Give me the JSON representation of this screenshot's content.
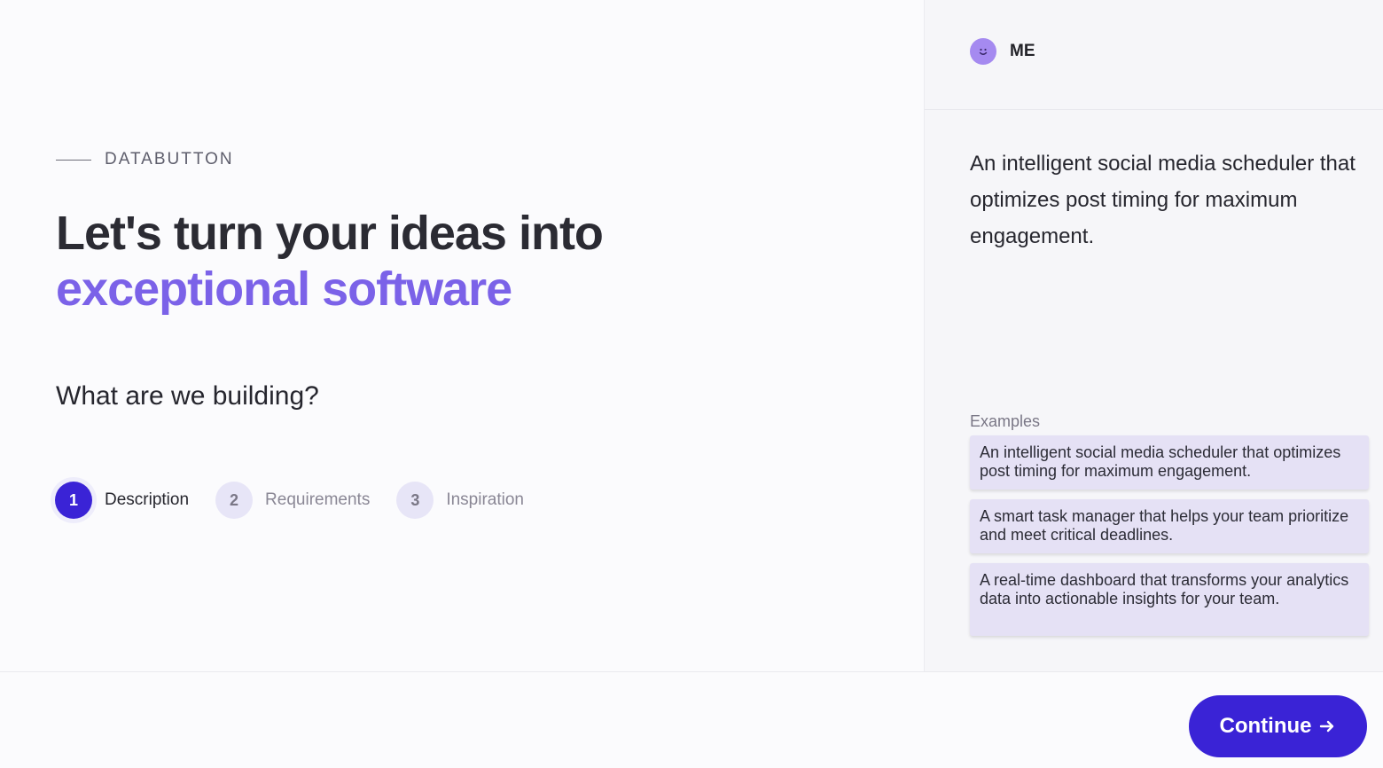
{
  "brand": {
    "eyebrow": "DATABUTTON"
  },
  "hero": {
    "line1": "Let's turn your ideas into",
    "line2": "exceptional software",
    "accent_color": "#7b62e8"
  },
  "question": "What are we building?",
  "steps": [
    {
      "number": "1",
      "label": "Description",
      "active": true
    },
    {
      "number": "2",
      "label": "Requirements",
      "active": false
    },
    {
      "number": "3",
      "label": "Inspiration",
      "active": false
    }
  ],
  "panel": {
    "author": "ME",
    "avatar_icon": "smiley-face-icon",
    "prompt": "An intelligent social media scheduler that optimizes post timing for maximum engagement.",
    "examples_label": "Examples",
    "examples": [
      "An intelligent social media scheduler that optimizes post timing for maximum engagement.",
      "A smart task manager that helps your team prioritize and meet critical deadlines.",
      "A real-time dashboard that transforms your analytics data into actionable insights for your team."
    ]
  },
  "footer": {
    "continue_label": "Continue",
    "continue_icon": "arrow-right-icon"
  },
  "colors": {
    "primary": "#3a23d6",
    "example_bg": "#e5e1f5"
  }
}
